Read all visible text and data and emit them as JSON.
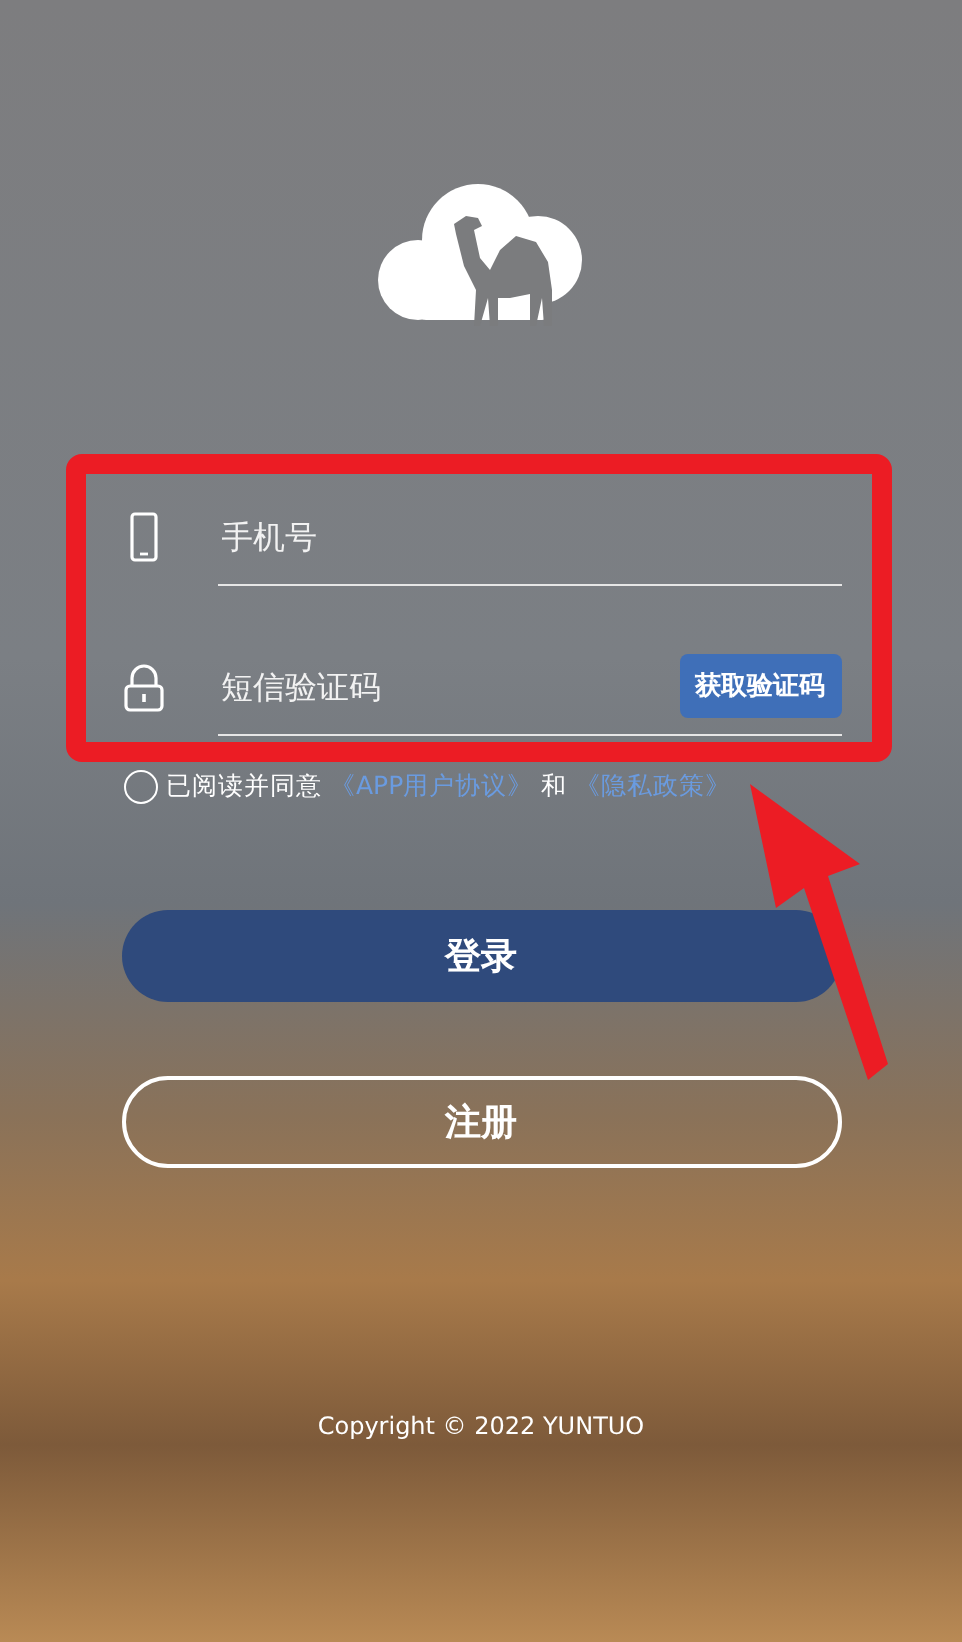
{
  "fields": [
    {
      "kind": "phone",
      "placeholder": "手机号"
    },
    {
      "kind": "code",
      "placeholder": "短信验证码",
      "action": "获取验证码"
    }
  ],
  "agreement": {
    "checked": false,
    "prefix": "已阅读并同意",
    "links": [
      "《APP用户协议》",
      "《隐私政策》"
    ],
    "joiner": "和"
  },
  "buttons": [
    {
      "kind": "primary",
      "label": "登录"
    },
    {
      "kind": "outline",
      "label": "注册"
    }
  ],
  "copyright": "Copyright © 2022 YUNTUO"
}
